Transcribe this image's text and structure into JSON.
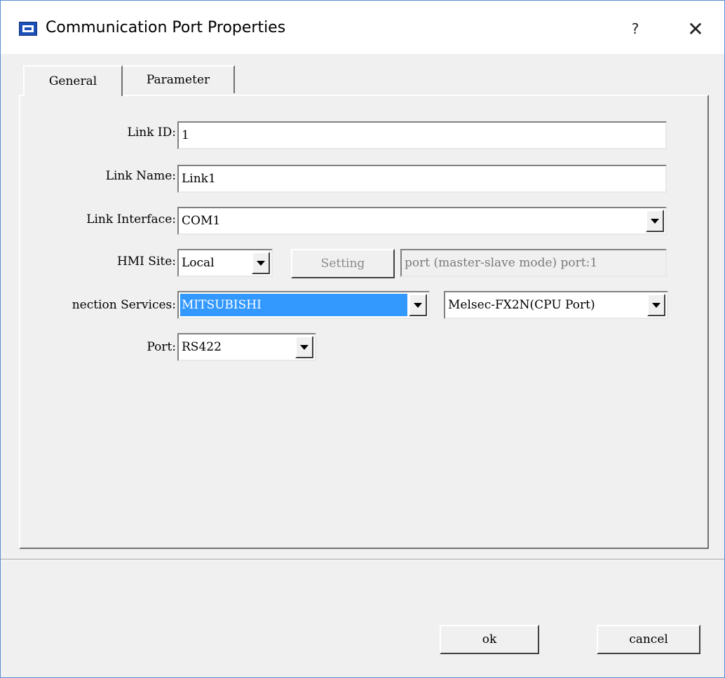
{
  "window": {
    "title": "Communication Port Properties",
    "help_label": "?",
    "close_label": "✕",
    "icon": "hmi-app-icon"
  },
  "tabs": [
    {
      "label": "General",
      "selected": true
    },
    {
      "label": "Parameter",
      "selected": false
    }
  ],
  "form": {
    "link_id": {
      "label": "Link ID:",
      "value": "1"
    },
    "link_name": {
      "label": "Link Name:",
      "value": "Link1"
    },
    "link_interface": {
      "label": "Link Interface:",
      "value": "COM1"
    },
    "hmi_site": {
      "label": "HMI Site:",
      "value": "Local",
      "setting_label": "Setting",
      "info": "port (master-slave mode) port:1"
    },
    "connection_services": {
      "label": "nection Services:",
      "vendor": "MITSUBISHI",
      "device": "Melsec-FX2N(CPU Port)"
    },
    "port": {
      "label": "Port:",
      "value": "RS422"
    }
  },
  "buttons": {
    "ok": "ok",
    "cancel": "cancel"
  },
  "colors": {
    "selection": "#3399ff",
    "dialog_bg": "#f0f0f0",
    "window_border": "#5b8fd6"
  }
}
